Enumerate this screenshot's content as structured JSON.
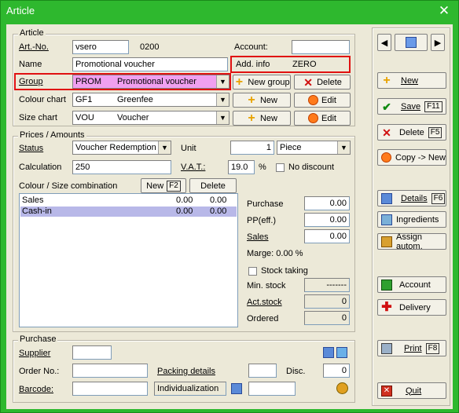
{
  "window": {
    "title": "Article",
    "close_glyph": "✕"
  },
  "article": {
    "legend": "Article",
    "art_no_label": "Art.-No.",
    "art_no": "vsero",
    "art_no_suffix": "0200",
    "account_label": "Account:",
    "account_value": "",
    "name_label": "Name",
    "name_value": "Promotional voucher",
    "add_info_label": "Add. info",
    "add_info_value": "ZERO",
    "group_label": "Group",
    "group_code": "PROM",
    "group_name": "Promotional voucher",
    "colour_label": "Colour chart",
    "colour_code": "GF1",
    "colour_name": "Greenfee",
    "size_label": "Size chart",
    "size_code": "VOU",
    "size_name": "Voucher",
    "new_group_label": "New group",
    "delete_label": "Delete",
    "new_label": "New",
    "edit_label": "Edit"
  },
  "prices": {
    "legend": "Prices / Amounts",
    "status_label": "Status",
    "status_value": "Voucher Redemption",
    "unit_label": "Unit",
    "unit_value": "1",
    "unit_type": "Piece",
    "calc_label": "Calculation",
    "calc_value": "250",
    "vat_label": "V.A.T.:",
    "vat_value": "19.0",
    "vat_unit": "%",
    "no_discount_label": "No discount",
    "combo_label": "Colour / Size combination",
    "new_btn": "New",
    "new_key": "F2",
    "delete_btn": "Delete",
    "rows": [
      {
        "name": "Sales",
        "v1": "0.00",
        "v2": "0.00"
      },
      {
        "name": "Cash-in",
        "v1": "0.00",
        "v2": "0.00"
      }
    ],
    "purchase_label": "Purchase",
    "purchase_value": "0.00",
    "pp_label": "PP(eff.)",
    "pp_value": "0.00",
    "sales_label": "Sales",
    "sales_value": "0.00",
    "marge": "Marge: 0.00 %",
    "stock_taking_label": "Stock taking",
    "min_stock_label": "Min. stock",
    "min_stock_value": "-------",
    "act_stock_label": "Act.stock",
    "act_stock_value": "0",
    "ordered_label": "Ordered",
    "ordered_value": "0"
  },
  "purchase": {
    "legend": "Purchase",
    "supplier_label": "Supplier",
    "order_label": "Order No.:",
    "packing_label": "Packing details",
    "disc_label": "Disc.",
    "disc_value": "0",
    "barcode_label": "Barcode:",
    "individualization": "Individualization"
  },
  "right_panel": {
    "new": "New",
    "save": "Save",
    "save_key": "F11",
    "delete": "Delete",
    "delete_key": "F5",
    "copy": "Copy -> New",
    "details": "Details",
    "details_key": "F6",
    "ingredients": "Ingredients",
    "assign": "Assign autom.",
    "account": "Account",
    "delivery": "Delivery",
    "print": "Print",
    "print_key": "F8",
    "quit": "Quit"
  }
}
